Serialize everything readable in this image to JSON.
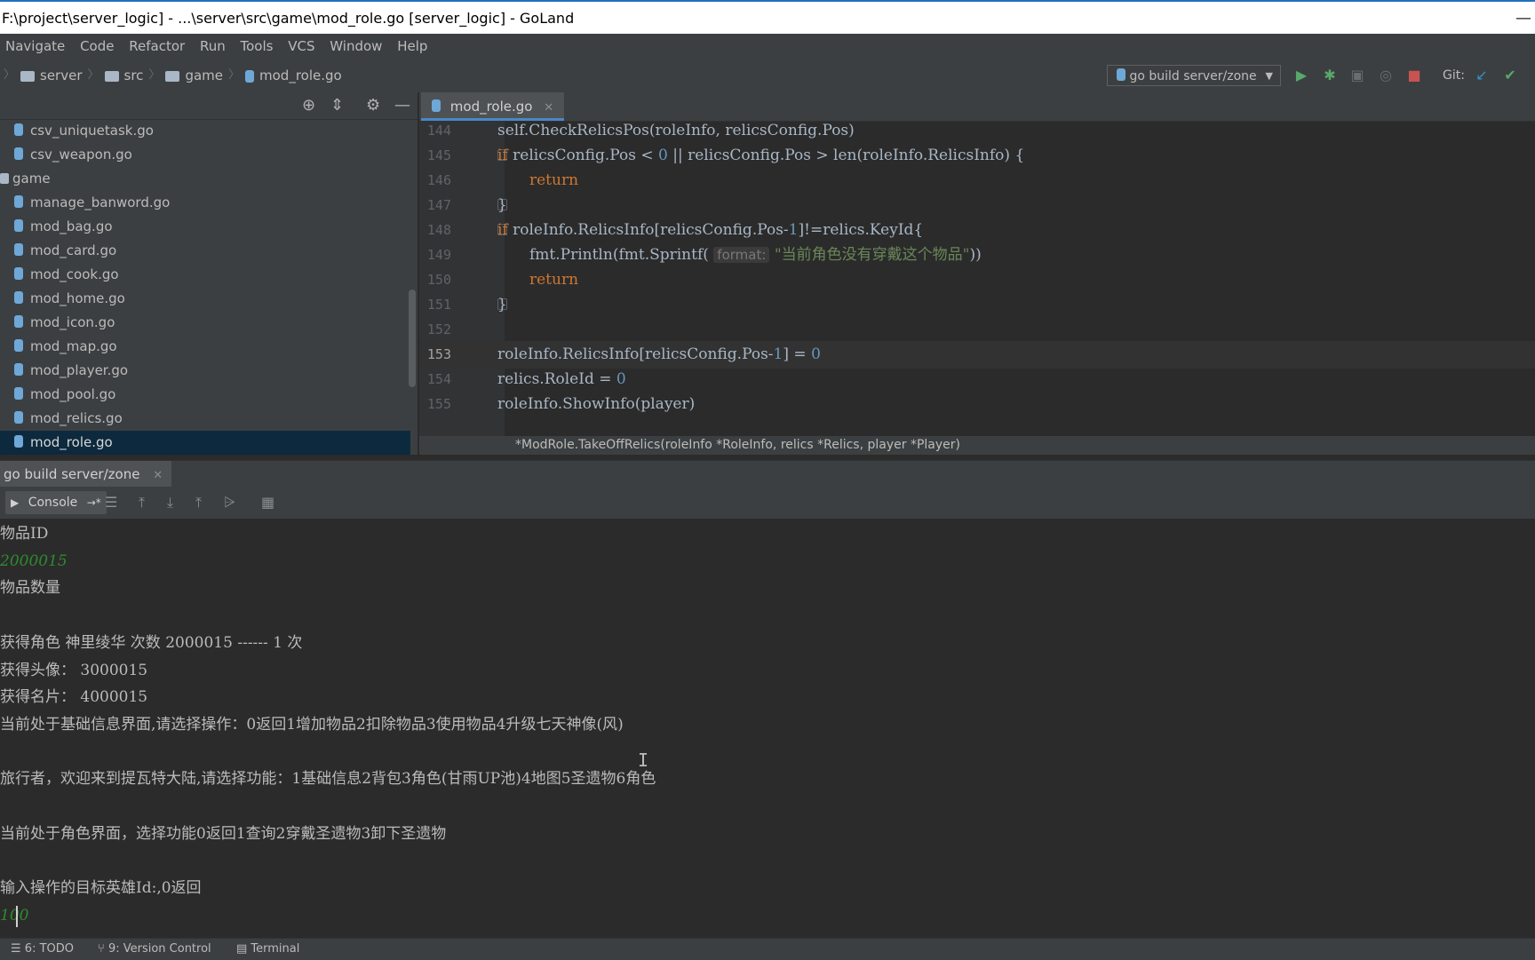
{
  "window": {
    "title": "F:\\project\\server_logic] - ...\\server\\src\\game\\mod_role.go [server_logic] - GoLand",
    "minimize": "—"
  },
  "menu": [
    "Navigate",
    "Code",
    "Refactor",
    "Run",
    "Tools",
    "VCS",
    "Window",
    "Help"
  ],
  "breadcrumb": {
    "items": [
      "server",
      "src",
      "game",
      "mod_role.go"
    ]
  },
  "toolbar": {
    "run_config": "go build server/zone",
    "git_label": "Git:",
    "icons": [
      "run-icon",
      "debug-icon",
      "coverage-icon",
      "profile-icon",
      "stop-icon",
      "vcs-update-icon",
      "vcs-commit-icon"
    ]
  },
  "project": {
    "files": [
      {
        "name": "csv_uniquetask.go",
        "type": "go-file"
      },
      {
        "name": "csv_weapon.go",
        "type": "go-file"
      },
      {
        "name": "game",
        "type": "folder"
      },
      {
        "name": "manage_banword.go",
        "type": "go-file"
      },
      {
        "name": "mod_bag.go",
        "type": "go-file"
      },
      {
        "name": "mod_card.go",
        "type": "go-file"
      },
      {
        "name": "mod_cook.go",
        "type": "go-file"
      },
      {
        "name": "mod_home.go",
        "type": "go-file"
      },
      {
        "name": "mod_icon.go",
        "type": "go-file"
      },
      {
        "name": "mod_map.go",
        "type": "go-file"
      },
      {
        "name": "mod_player.go",
        "type": "go-file"
      },
      {
        "name": "mod_pool.go",
        "type": "go-file"
      },
      {
        "name": "mod_relics.go",
        "type": "go-file"
      },
      {
        "name": "mod_role.go",
        "type": "go-file",
        "selected": true
      }
    ]
  },
  "editor": {
    "tab": "mod_role.go",
    "current_line": "153",
    "lines": [
      {
        "num": "144",
        "text": "self.CheckRelicsPos(roleInfo, relicsConfig.Pos)"
      },
      {
        "num": "145",
        "text": "if relicsConfig.Pos < 0 || relicsConfig.Pos > len(roleInfo.RelicsInfo) {"
      },
      {
        "num": "146",
        "text": "return"
      },
      {
        "num": "147",
        "text": "}"
      },
      {
        "num": "148",
        "text": "if roleInfo.RelicsInfo[relicsConfig.Pos-1]!=relics.KeyId{"
      },
      {
        "num": "149",
        "text": "fmt.Println(fmt.Sprintf( format: \"当前角色没有穿戴这个物品\"))"
      },
      {
        "num": "150",
        "text": "return"
      },
      {
        "num": "151",
        "text": "}"
      },
      {
        "num": "152",
        "text": ""
      },
      {
        "num": "153",
        "text": "roleInfo.RelicsInfo[relicsConfig.Pos-1] = 0"
      },
      {
        "num": "154",
        "text": "relics.RoleId = 0"
      },
      {
        "num": "155",
        "text": "roleInfo.ShowInfo(player)"
      }
    ],
    "hint_label": "format:",
    "breadcrumb_signature": "*ModRole.TakeOffRelics(roleInfo *RoleInfo, relics *Relics, player *Player)"
  },
  "run_panel": {
    "tab": "go build server/zone",
    "console_label": "Console"
  },
  "console": {
    "lines": [
      {
        "text": "物品ID",
        "style": "normal"
      },
      {
        "text": "2000015",
        "style": "input"
      },
      {
        "text": "物品数量",
        "style": "normal"
      },
      {
        "text": "",
        "style": "input"
      },
      {
        "text": "获得角色 神里绫华 次数 2000015 ------ 1 次",
        "style": "normal"
      },
      {
        "text": "获得头像： 3000015",
        "style": "normal"
      },
      {
        "text": "获得名片： 4000015",
        "style": "normal"
      },
      {
        "text": "当前处于基础信息界面,请选择操作：0返回1增加物品2扣除物品3使用物品4升级七天神像(风)",
        "style": "normal"
      },
      {
        "text": "",
        "style": "input"
      },
      {
        "text": "旅行者，欢迎来到提瓦特大陆,请选择功能：1基础信息2背包3角色(甘雨UP池)4地图5圣遗物6角色",
        "style": "normal"
      },
      {
        "text": "",
        "style": "input"
      },
      {
        "text": "当前处于角色界面，选择功能0返回1查询2穿戴圣遗物3卸下圣遗物",
        "style": "normal"
      },
      {
        "text": "",
        "style": "input"
      },
      {
        "text": "输入操作的目标英雄Id:,0返回",
        "style": "normal"
      },
      {
        "text": "100",
        "style": "input"
      }
    ]
  },
  "statusbar": {
    "todo": "6: TODO",
    "vcs": "9: Version Control",
    "terminal": "Terminal"
  }
}
